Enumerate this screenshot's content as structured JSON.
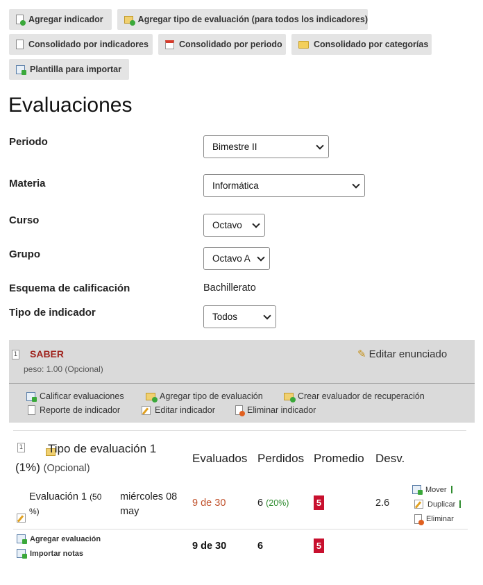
{
  "toolbar": {
    "add_indicator": "Agregar indicador",
    "add_eval_type": "Agregar tipo de evaluación (para todos los indicadores)",
    "by_indicators": "Consolidado por indicadores",
    "by_period": "Consolidado por periodo",
    "by_categories": "Consolidado por categorías",
    "import_template": "Plantilla para importar"
  },
  "page_title": "Evaluaciones",
  "form": {
    "periodo": {
      "label": "Periodo",
      "value": "Bimestre II"
    },
    "materia": {
      "label": "Materia",
      "value": "Informática"
    },
    "curso": {
      "label": "Curso",
      "value": "Octavo"
    },
    "grupo": {
      "label": "Grupo",
      "value": "Octavo A"
    },
    "esquema": {
      "label": "Esquema de calificación",
      "value": "Bachillerato"
    },
    "tipo_indicador": {
      "label": "Tipo de indicador",
      "value": "Todos"
    }
  },
  "indicator": {
    "number": "1",
    "title": "SABER",
    "weight": "peso: 1.00 (Opcional)",
    "edit_statement": "Editar enunciado",
    "actions": {
      "grade": "Calificar evaluaciones",
      "add_type": "Agregar tipo de evaluación",
      "recovery": "Crear evaluador de recuperación",
      "report": "Reporte de indicador",
      "edit": "Editar indicador",
      "delete": "Eliminar indicador"
    }
  },
  "eval_table": {
    "type_number": "1",
    "type_title": "Tipo de evaluación 1",
    "type_percent": "(1%)",
    "type_optional": "(Opcional)",
    "headers": {
      "evaluados": "Evaluados",
      "perdidos": "Perdidos",
      "promedio": "Promedio",
      "desv": "Desv."
    },
    "row": {
      "name": "Evaluación 1",
      "percent": "(50 %)",
      "date": "miércoles 08 may",
      "evaluados": "9 de 30",
      "perdidos": "6",
      "perdidos_pct": "(20%)",
      "promedio": "5",
      "desv": "2.6",
      "move": "Mover",
      "duplicate": "Duplicar",
      "delete": "Eliminar"
    },
    "footer": {
      "add_eval": "Agregar evaluación",
      "import_notes": "Importar notas",
      "evaluados": "9 de 30",
      "perdidos": "6",
      "promedio": "5"
    }
  },
  "colors": {
    "accent_red": "#c8102e",
    "title_red": "#a0241e",
    "green": "#2e8b2e",
    "orange": "#c0502a"
  }
}
